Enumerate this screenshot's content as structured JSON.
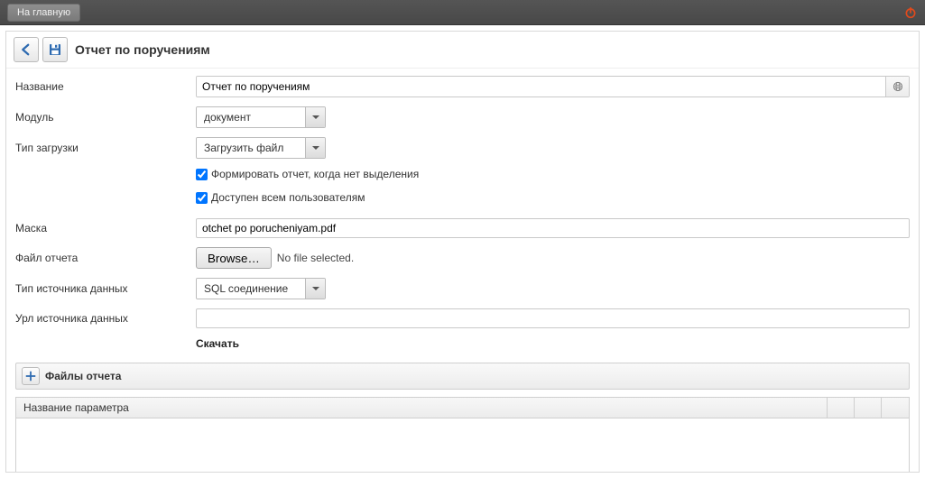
{
  "topbar": {
    "home_label": "На главную"
  },
  "toolbar": {
    "page_title": "Отчет по поручениям"
  },
  "form": {
    "name_label": "Название",
    "name_value": "Отчет по поручениям",
    "module_label": "Модуль",
    "module_value": "документ",
    "load_type_label": "Тип загрузки",
    "load_type_value": "Загрузить файл",
    "cb_generate_label": "Формировать отчет, когда нет выделения",
    "cb_available_label": "Доступен всем пользователям",
    "mask_label": "Маска",
    "mask_value": "otchet po porucheniyam.pdf",
    "file_label": "Файл отчета",
    "browse_label": "Browse…",
    "file_status": "No file selected.",
    "datasource_type_label": "Тип источника данных",
    "datasource_type_value": "SQL соединение",
    "datasource_url_label": "Урл источника данных",
    "datasource_url_value": "",
    "download_label": "Скачать"
  },
  "files_section": {
    "title": "Файлы отчета"
  },
  "table": {
    "header_param_name": "Название параметра"
  }
}
